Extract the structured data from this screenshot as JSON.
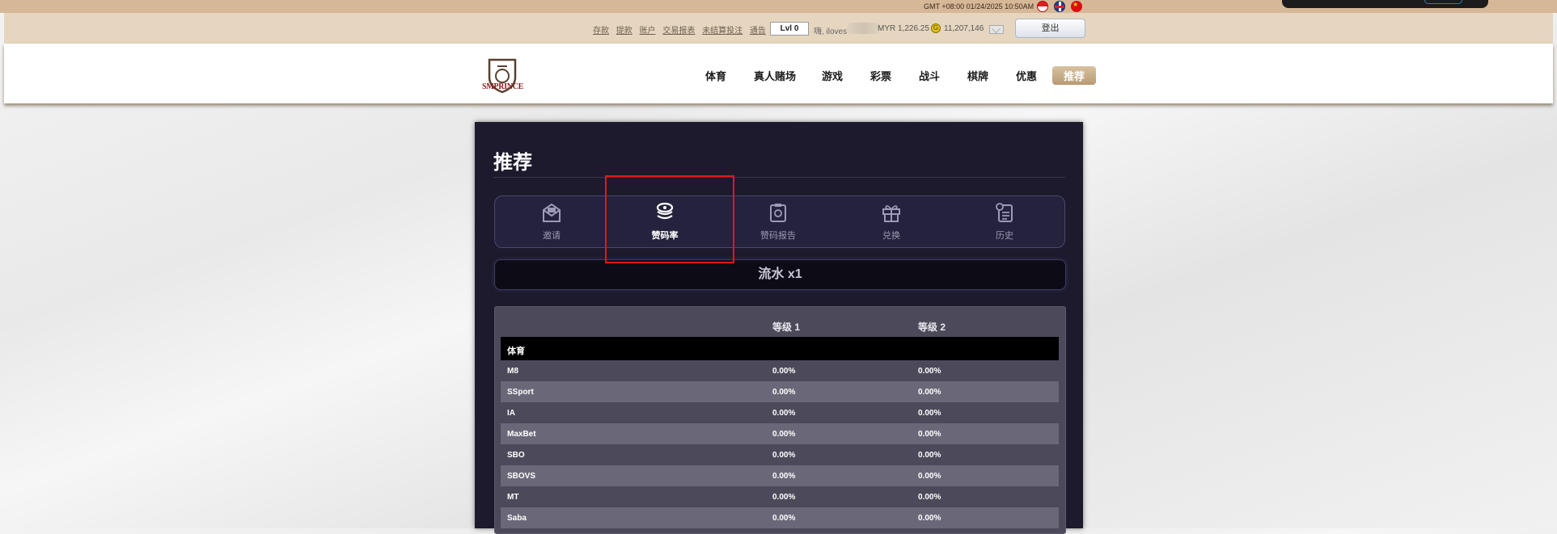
{
  "topbar": {
    "clock": "GMT +08:00 01/24/2025 10:50AM",
    "flags": [
      "malaysia-flag-icon",
      "uk-flag-icon",
      "china-flag-icon"
    ]
  },
  "account": {
    "links": [
      "存款",
      "提款",
      "账户",
      "交易报表",
      "未结算投注",
      "通告"
    ],
    "level": "Lvl 0",
    "greeting": "嗨, iloves",
    "balance": "MYR 1,226.25",
    "coin_symbol": "G",
    "credit": "11,207,146",
    "logout": "登出"
  },
  "nav": {
    "logo_text": "SMPRINCE",
    "items": [
      "体育",
      "真人赌场",
      "游戏",
      "彩票",
      "战斗",
      "棋牌",
      "优惠",
      "推荐"
    ],
    "active_index": 7
  },
  "panel": {
    "title": "推荐",
    "tabs": [
      {
        "label": "邀请",
        "icon": "invite-envelope-icon"
      },
      {
        "label": "赞码率",
        "icon": "coin-stack-icon"
      },
      {
        "label": "赞码报告",
        "icon": "clipboard-report-icon"
      },
      {
        "label": "兑换",
        "icon": "gift-icon"
      },
      {
        "label": "历史",
        "icon": "history-document-icon"
      }
    ],
    "active_tab": 1,
    "multiplier": "流水 x1",
    "table": {
      "headers": [
        "等级 1",
        "等级 2"
      ],
      "category": "体育",
      "rows": [
        {
          "name": "M8",
          "l1": "0.00%",
          "l2": "0.00%"
        },
        {
          "name": "SSport",
          "l1": "0.00%",
          "l2": "0.00%"
        },
        {
          "name": "IA",
          "l1": "0.00%",
          "l2": "0.00%"
        },
        {
          "name": "MaxBet",
          "l1": "0.00%",
          "l2": "0.00%"
        },
        {
          "name": "SBO",
          "l1": "0.00%",
          "l2": "0.00%"
        },
        {
          "name": "SBOVS",
          "l1": "0.00%",
          "l2": "0.00%"
        },
        {
          "name": "MT",
          "l1": "0.00%",
          "l2": "0.00%"
        },
        {
          "name": "Saba",
          "l1": "0.00%",
          "l2": "0.00%"
        }
      ]
    }
  },
  "colors": {
    "top_strip": "#d6b898",
    "account_bar": "#e6d6c0",
    "panel_bg": "#1c1a2c",
    "active_nav": "#b89a72",
    "highlight_box": "#e01818"
  }
}
